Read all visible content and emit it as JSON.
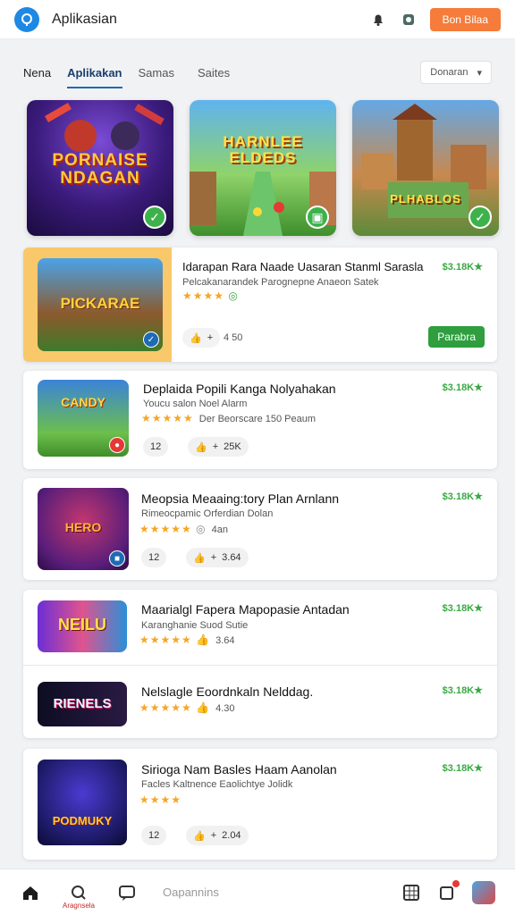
{
  "header": {
    "app_title": "Aplikasian",
    "action_button": "Bon Bilaa"
  },
  "tabs": [
    {
      "label": "Nena"
    },
    {
      "label": "Aplikakan"
    },
    {
      "label": "Samas"
    },
    {
      "label": "Saites"
    }
  ],
  "sort": {
    "label": "Donaran"
  },
  "featured": [
    {
      "art": "PORNAISE NDAGAN"
    },
    {
      "art": "HARNLEE ELDEDS"
    },
    {
      "art": "PLHABLOS"
    }
  ],
  "highlight": {
    "title": "Idarapan Rara Naade Uasaran Stanml Sarasla",
    "subtitle": "Pelcakanarandek Parognepne Anaeon Satek",
    "price": "$3.18K★",
    "count": "4 50",
    "install_label": "Parabra",
    "art": "PICKARAE"
  },
  "apps": [
    {
      "title": "Deplaida Popili Kanga Nolyahakan",
      "subtitle": "Youcu salon Noel Alarm",
      "rating_note": "Der Beorscare 150 Peaum",
      "price": "$3.18K★",
      "chip1": "12",
      "chip2": "25K",
      "art": "CANDY"
    },
    {
      "title": "Meopsia Meaaing:tory Plan Arnlann",
      "subtitle": "Rimeocpamic Orferdian Dolan",
      "rating_note": "4an",
      "price": "$3.18K★",
      "chip1": "12",
      "chip2": "3.64",
      "art": "HERO"
    },
    {
      "title": "Maarialgl Fapera Mapopasie Antadan",
      "subtitle": "Karanghanie Suod Sutie",
      "rating_note": "3.64",
      "price": "$3.18K★",
      "art": "NEILU"
    },
    {
      "title": "Nelslagle Eoordnkaln Nelddag.",
      "subtitle": "",
      "rating_note": "4.30",
      "price": "$3.18K★",
      "art": "RIENELS"
    },
    {
      "title": "Sirioga Nam Basles Haam Aanolan",
      "subtitle": "Facles Kaltnence Eaolichtye Jolidk",
      "rating_note": "",
      "price": "$3.18K★",
      "chip1": "12",
      "chip2": "2.04",
      "art": "PODMUKY"
    }
  ],
  "bottom_nav": {
    "label_small": "Aragnsela",
    "label_text": "Oapannins"
  },
  "colors": {
    "accent": "#1e88e5",
    "install": "#2e9e3f",
    "price": "#3aa845",
    "orange": "#f57c3a",
    "star": "#f5a623"
  }
}
